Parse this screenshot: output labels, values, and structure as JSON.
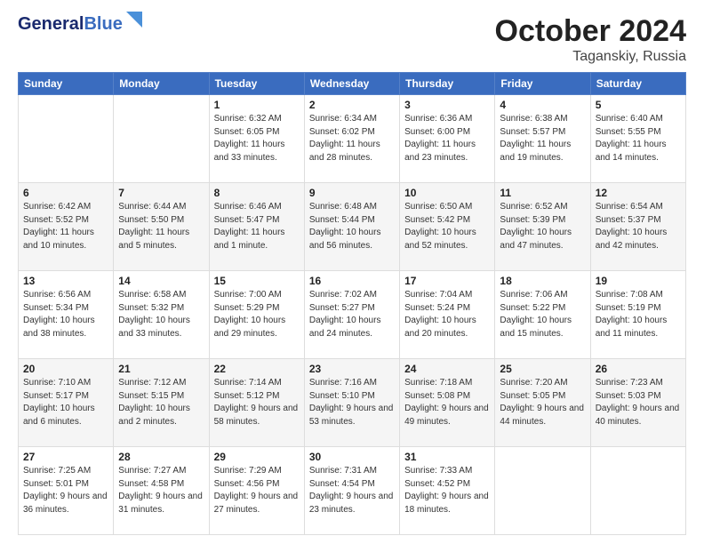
{
  "logo": {
    "line1": "General",
    "line2": "Blue"
  },
  "header": {
    "month": "October 2024",
    "location": "Taganskiy, Russia"
  },
  "weekdays": [
    "Sunday",
    "Monday",
    "Tuesday",
    "Wednesday",
    "Thursday",
    "Friday",
    "Saturday"
  ],
  "weeks": [
    [
      null,
      null,
      {
        "day": "1",
        "sunrise": "Sunrise: 6:32 AM",
        "sunset": "Sunset: 6:05 PM",
        "daylight": "Daylight: 11 hours and 33 minutes."
      },
      {
        "day": "2",
        "sunrise": "Sunrise: 6:34 AM",
        "sunset": "Sunset: 6:02 PM",
        "daylight": "Daylight: 11 hours and 28 minutes."
      },
      {
        "day": "3",
        "sunrise": "Sunrise: 6:36 AM",
        "sunset": "Sunset: 6:00 PM",
        "daylight": "Daylight: 11 hours and 23 minutes."
      },
      {
        "day": "4",
        "sunrise": "Sunrise: 6:38 AM",
        "sunset": "Sunset: 5:57 PM",
        "daylight": "Daylight: 11 hours and 19 minutes."
      },
      {
        "day": "5",
        "sunrise": "Sunrise: 6:40 AM",
        "sunset": "Sunset: 5:55 PM",
        "daylight": "Daylight: 11 hours and 14 minutes."
      }
    ],
    [
      {
        "day": "6",
        "sunrise": "Sunrise: 6:42 AM",
        "sunset": "Sunset: 5:52 PM",
        "daylight": "Daylight: 11 hours and 10 minutes."
      },
      {
        "day": "7",
        "sunrise": "Sunrise: 6:44 AM",
        "sunset": "Sunset: 5:50 PM",
        "daylight": "Daylight: 11 hours and 5 minutes."
      },
      {
        "day": "8",
        "sunrise": "Sunrise: 6:46 AM",
        "sunset": "Sunset: 5:47 PM",
        "daylight": "Daylight: 11 hours and 1 minute."
      },
      {
        "day": "9",
        "sunrise": "Sunrise: 6:48 AM",
        "sunset": "Sunset: 5:44 PM",
        "daylight": "Daylight: 10 hours and 56 minutes."
      },
      {
        "day": "10",
        "sunrise": "Sunrise: 6:50 AM",
        "sunset": "Sunset: 5:42 PM",
        "daylight": "Daylight: 10 hours and 52 minutes."
      },
      {
        "day": "11",
        "sunrise": "Sunrise: 6:52 AM",
        "sunset": "Sunset: 5:39 PM",
        "daylight": "Daylight: 10 hours and 47 minutes."
      },
      {
        "day": "12",
        "sunrise": "Sunrise: 6:54 AM",
        "sunset": "Sunset: 5:37 PM",
        "daylight": "Daylight: 10 hours and 42 minutes."
      }
    ],
    [
      {
        "day": "13",
        "sunrise": "Sunrise: 6:56 AM",
        "sunset": "Sunset: 5:34 PM",
        "daylight": "Daylight: 10 hours and 38 minutes."
      },
      {
        "day": "14",
        "sunrise": "Sunrise: 6:58 AM",
        "sunset": "Sunset: 5:32 PM",
        "daylight": "Daylight: 10 hours and 33 minutes."
      },
      {
        "day": "15",
        "sunrise": "Sunrise: 7:00 AM",
        "sunset": "Sunset: 5:29 PM",
        "daylight": "Daylight: 10 hours and 29 minutes."
      },
      {
        "day": "16",
        "sunrise": "Sunrise: 7:02 AM",
        "sunset": "Sunset: 5:27 PM",
        "daylight": "Daylight: 10 hours and 24 minutes."
      },
      {
        "day": "17",
        "sunrise": "Sunrise: 7:04 AM",
        "sunset": "Sunset: 5:24 PM",
        "daylight": "Daylight: 10 hours and 20 minutes."
      },
      {
        "day": "18",
        "sunrise": "Sunrise: 7:06 AM",
        "sunset": "Sunset: 5:22 PM",
        "daylight": "Daylight: 10 hours and 15 minutes."
      },
      {
        "day": "19",
        "sunrise": "Sunrise: 7:08 AM",
        "sunset": "Sunset: 5:19 PM",
        "daylight": "Daylight: 10 hours and 11 minutes."
      }
    ],
    [
      {
        "day": "20",
        "sunrise": "Sunrise: 7:10 AM",
        "sunset": "Sunset: 5:17 PM",
        "daylight": "Daylight: 10 hours and 6 minutes."
      },
      {
        "day": "21",
        "sunrise": "Sunrise: 7:12 AM",
        "sunset": "Sunset: 5:15 PM",
        "daylight": "Daylight: 10 hours and 2 minutes."
      },
      {
        "day": "22",
        "sunrise": "Sunrise: 7:14 AM",
        "sunset": "Sunset: 5:12 PM",
        "daylight": "Daylight: 9 hours and 58 minutes."
      },
      {
        "day": "23",
        "sunrise": "Sunrise: 7:16 AM",
        "sunset": "Sunset: 5:10 PM",
        "daylight": "Daylight: 9 hours and 53 minutes."
      },
      {
        "day": "24",
        "sunrise": "Sunrise: 7:18 AM",
        "sunset": "Sunset: 5:08 PM",
        "daylight": "Daylight: 9 hours and 49 minutes."
      },
      {
        "day": "25",
        "sunrise": "Sunrise: 7:20 AM",
        "sunset": "Sunset: 5:05 PM",
        "daylight": "Daylight: 9 hours and 44 minutes."
      },
      {
        "day": "26",
        "sunrise": "Sunrise: 7:23 AM",
        "sunset": "Sunset: 5:03 PM",
        "daylight": "Daylight: 9 hours and 40 minutes."
      }
    ],
    [
      {
        "day": "27",
        "sunrise": "Sunrise: 7:25 AM",
        "sunset": "Sunset: 5:01 PM",
        "daylight": "Daylight: 9 hours and 36 minutes."
      },
      {
        "day": "28",
        "sunrise": "Sunrise: 7:27 AM",
        "sunset": "Sunset: 4:58 PM",
        "daylight": "Daylight: 9 hours and 31 minutes."
      },
      {
        "day": "29",
        "sunrise": "Sunrise: 7:29 AM",
        "sunset": "Sunset: 4:56 PM",
        "daylight": "Daylight: 9 hours and 27 minutes."
      },
      {
        "day": "30",
        "sunrise": "Sunrise: 7:31 AM",
        "sunset": "Sunset: 4:54 PM",
        "daylight": "Daylight: 9 hours and 23 minutes."
      },
      {
        "day": "31",
        "sunrise": "Sunrise: 7:33 AM",
        "sunset": "Sunset: 4:52 PM",
        "daylight": "Daylight: 9 hours and 18 minutes."
      },
      null,
      null
    ]
  ]
}
